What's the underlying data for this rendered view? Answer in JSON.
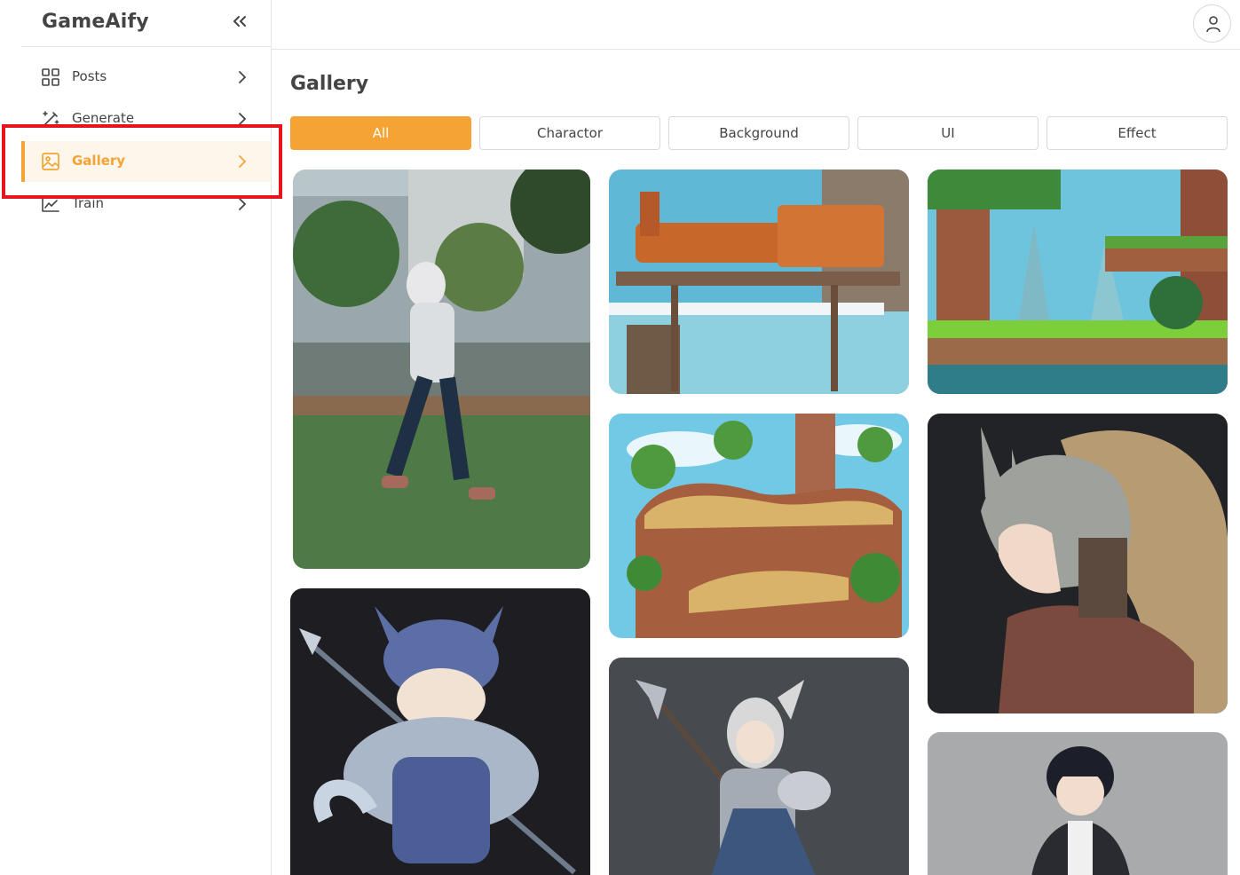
{
  "app": {
    "brand": "GameAify"
  },
  "sidebar": {
    "items": [
      {
        "label": "Posts",
        "icon": "grid-icon",
        "active": false
      },
      {
        "label": "Generate",
        "icon": "magic-wand-icon",
        "active": false
      },
      {
        "label": "Gallery",
        "icon": "image-icon",
        "active": true
      },
      {
        "label": "Train",
        "icon": "line-chart-icon",
        "active": false
      }
    ]
  },
  "header": {
    "avatar_icon": "user-icon"
  },
  "page": {
    "title": "Gallery"
  },
  "filters": [
    {
      "label": "All",
      "active": true
    },
    {
      "label": "Charactor",
      "active": false
    },
    {
      "label": "Background",
      "active": false
    },
    {
      "label": "UI",
      "active": false
    },
    {
      "label": "Effect",
      "active": false
    }
  ],
  "gallery": {
    "items": [
      {
        "subject": "hooded boy walking in park"
      },
      {
        "subject": "dragon knight chibi with spear"
      },
      {
        "subject": "rusty pipe machine over waterfall"
      },
      {
        "subject": "floating rock island with path"
      },
      {
        "subject": "elf knight with halberd"
      },
      {
        "subject": "jungle cliffs platform scene"
      },
      {
        "subject": "dragon helmet warrior portrait"
      },
      {
        "subject": "dark haired boy in jacket"
      }
    ]
  },
  "colors": {
    "accent": "#f5a334",
    "active_bg": "#fdf6ea",
    "annotation_red": "#e8141b",
    "border": "#d9d9d9"
  }
}
